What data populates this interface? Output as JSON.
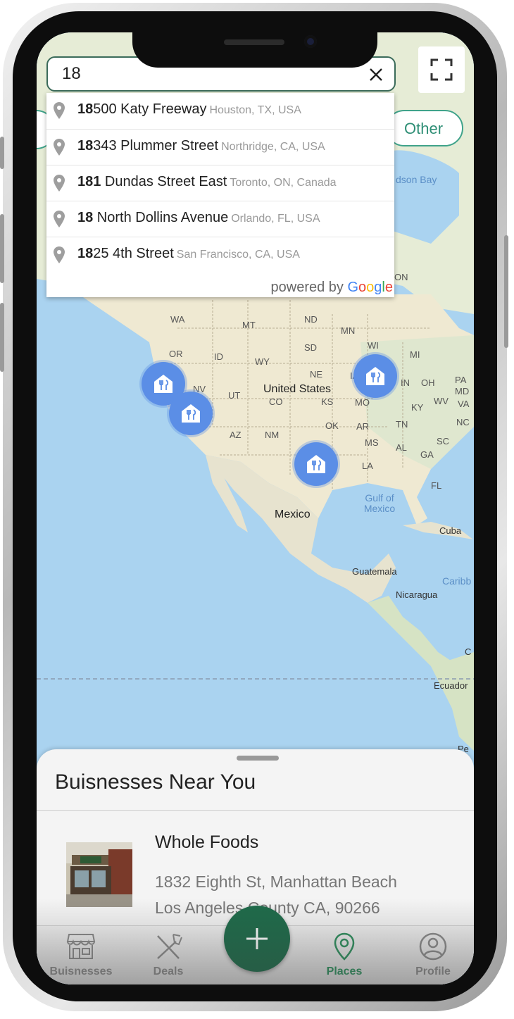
{
  "search": {
    "value": "18",
    "clear_icon": "close-icon",
    "expand_icon": "fullscreen-icon"
  },
  "filter_chip": {
    "label": "Other"
  },
  "suggestions": [
    {
      "match": "18",
      "rest": "500 Katy Freeway",
      "secondary": "Houston, TX, USA"
    },
    {
      "match": "18",
      "rest": "343 Plummer Street",
      "secondary": "Northridge, CA, USA"
    },
    {
      "match": "181",
      "rest": " Dundas Street East",
      "secondary": "Toronto, ON, Canada"
    },
    {
      "match": "18",
      "rest": " North Dollins Avenue",
      "secondary": "Orlando, FL, USA"
    },
    {
      "match": "18",
      "rest": "25 4th Street",
      "secondary": "San Francisco, CA, USA"
    }
  ],
  "powered_by": {
    "prefix": "powered by ",
    "g": [
      "G",
      "o",
      "o",
      "g",
      "l",
      "e"
    ]
  },
  "map": {
    "country_labels": [
      "United States",
      "Mexico"
    ],
    "state_labels": [
      "WA",
      "MT",
      "ND",
      "MN",
      "OR",
      "ID",
      "SD",
      "WY",
      "WI",
      "MI",
      "NE",
      "NV",
      "UT",
      "CO",
      "KS",
      "IA",
      "IN",
      "OH",
      "PA",
      "MD",
      "VA",
      "KY",
      "WV",
      "MO",
      "AZ",
      "NM",
      "OK",
      "AR",
      "TN",
      "SC",
      "NC",
      "MS",
      "AL",
      "GA",
      "LA",
      "FL",
      "ON"
    ],
    "place_labels": [
      "Cuba",
      "Guatemala",
      "Nicaragua",
      "Ecuador",
      "Caribb",
      "dson Bay",
      "C",
      "Pe"
    ],
    "water_labels": [
      "Gulf of Mexico"
    ],
    "markers": [
      "restaurant-marker",
      "restaurant-marker",
      "restaurant-marker",
      "restaurant-marker"
    ]
  },
  "sheet": {
    "title": "Buisnesses Near You",
    "items": [
      {
        "name": "Whole Foods",
        "address_line1": "1832 Eighth St, Manhattan Beach",
        "address_line2": "Los Angeles County CA, 90266"
      }
    ]
  },
  "tabs": [
    {
      "label": "Buisnesses",
      "icon": "storefront-icon",
      "active": false
    },
    {
      "label": "Deals",
      "icon": "utensils-icon",
      "active": false
    },
    {
      "label": "Places",
      "icon": "location-pin-icon",
      "active": true
    },
    {
      "label": "Profile",
      "icon": "user-circle-icon",
      "active": false
    }
  ],
  "fab": {
    "icon": "plus-icon"
  },
  "colors": {
    "accent": "#1e6b4a",
    "active_tab": "#2f8f5e",
    "marker": "#5b8ee6",
    "search_border": "#3b6b5a"
  }
}
